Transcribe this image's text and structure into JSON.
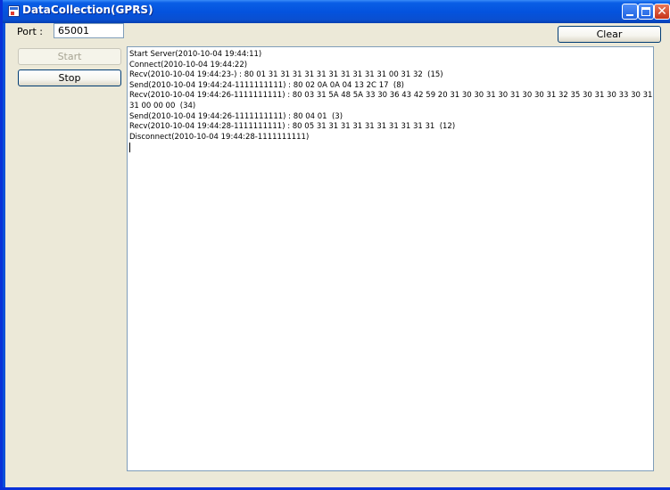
{
  "window": {
    "title": "DataCollection(GPRS)",
    "close_glyph": "✕"
  },
  "form": {
    "port_label": "Port :",
    "port_value": "65001",
    "clear_label": "Clear",
    "start_label": "Start",
    "stop_label": "Stop"
  },
  "log": {
    "lines": [
      "Start Server(2010-10-04 19:44:11)",
      "Connect(2010-10-04 19:44:22)",
      "Recv(2010-10-04 19:44:23-) : 80 01 31 31 31 31 31 31 31 31 31 31 00 31 32  (15)",
      "Send(2010-10-04 19:44:24-1111111111) : 80 02 0A 0A 04 13 2C 17  (8)",
      "Recv(2010-10-04 19:44:26-1111111111) : 80 03 31 5A 48 5A 33 30 36 43 42 59 20 31 30 30 31 30 31 30 30 31 32 35 30 31 30 33 30 31",
      "31 00 00 00  (34)",
      "Send(2010-10-04 19:44:26-1111111111) : 80 04 01  (3)",
      "Recv(2010-10-04 19:44:28-1111111111) : 80 05 31 31 31 31 31 31 31 31 31 31  (12)",
      "Disconnect(2010-10-04 19:44:28-1111111111)"
    ]
  },
  "colors": {
    "titlebar": "#0453de",
    "client_bg": "#ece9d8",
    "close_button": "#c63318"
  }
}
